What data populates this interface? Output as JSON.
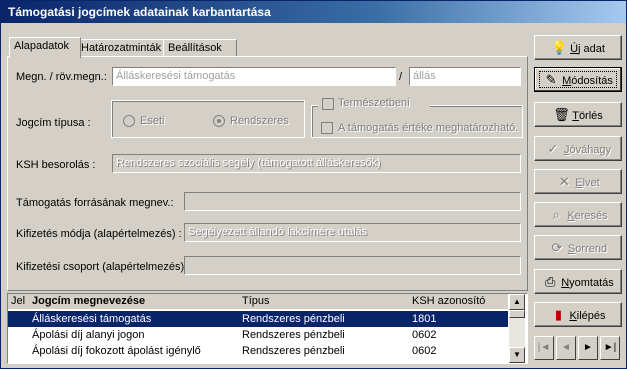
{
  "window": {
    "title": "Támogatási jogcímek adatainak karbantartása"
  },
  "tabs": [
    {
      "label": "Alapadatok"
    },
    {
      "label": "Határozatminták"
    },
    {
      "label": "Beállítások"
    }
  ],
  "form": {
    "name_label": "Megn. / röv.megn.:",
    "name_value": "Álláskeresési támogatás",
    "name_separator": "/",
    "short_value": "állás",
    "type_label": "Jogcím típusa :",
    "radio_eseti": "Eseti",
    "radio_rendszeres": "Rendszeres",
    "chk_termeszetbeni": "Természetbeni",
    "chk_ertek": "A támogatás  értéke meghatározható.",
    "ksh_label": "KSH besorolás :",
    "ksh_value": "Rendszeres szociális segély (támogatott álláskeresők)",
    "forras_label": "Támogatás forrásának megnev.:",
    "forras_value": "",
    "kifizetes_mod_label": "Kifizetés módja (alapértelmezés) :",
    "kifizetes_mod_value": "Segélyezett állandó lakcímére utalás",
    "kifizetes_csop_label": "Kifizetési csoport (alapértelmezés) :",
    "kifizetes_csop_value": ""
  },
  "buttons": {
    "uj": {
      "underline": "Ú",
      "rest": "j adat"
    },
    "modositas": {
      "underline": "M",
      "rest": "ódosítás"
    },
    "torles": {
      "underline": "T",
      "rest": "örlés"
    },
    "jovahagy": {
      "underline": "J",
      "rest": "óváhagy"
    },
    "elvet": {
      "underline": "E",
      "rest": "lvet"
    },
    "kereses": {
      "underline": "K",
      "rest": "eresés"
    },
    "sorrend": {
      "underline": "S",
      "rest": "orrend"
    },
    "nyomtatas": {
      "underline": "N",
      "rest": "yomtatás"
    },
    "kilepes": {
      "underline": "K",
      "rest": "ilépés"
    }
  },
  "table": {
    "headers": {
      "jel": "Jel",
      "name": "Jogcím megnevezése",
      "type": "Típus",
      "ksh": "KSH azonosító"
    },
    "rows": [
      {
        "name": "Álláskeresési támogatás",
        "type": "Rendszeres pénzbeli",
        "ksh": "1801"
      },
      {
        "name": "Ápolási díj alanyi jogon",
        "type": "Rendszeres pénzbeli",
        "ksh": "0602"
      },
      {
        "name": "Ápolási díj fokozott ápolást igénylő",
        "type": "Rendszeres pénzbeli",
        "ksh": "0602"
      }
    ]
  },
  "nav": {
    "first": "|◄",
    "prev": "◄",
    "next": "►",
    "last": "►|"
  }
}
